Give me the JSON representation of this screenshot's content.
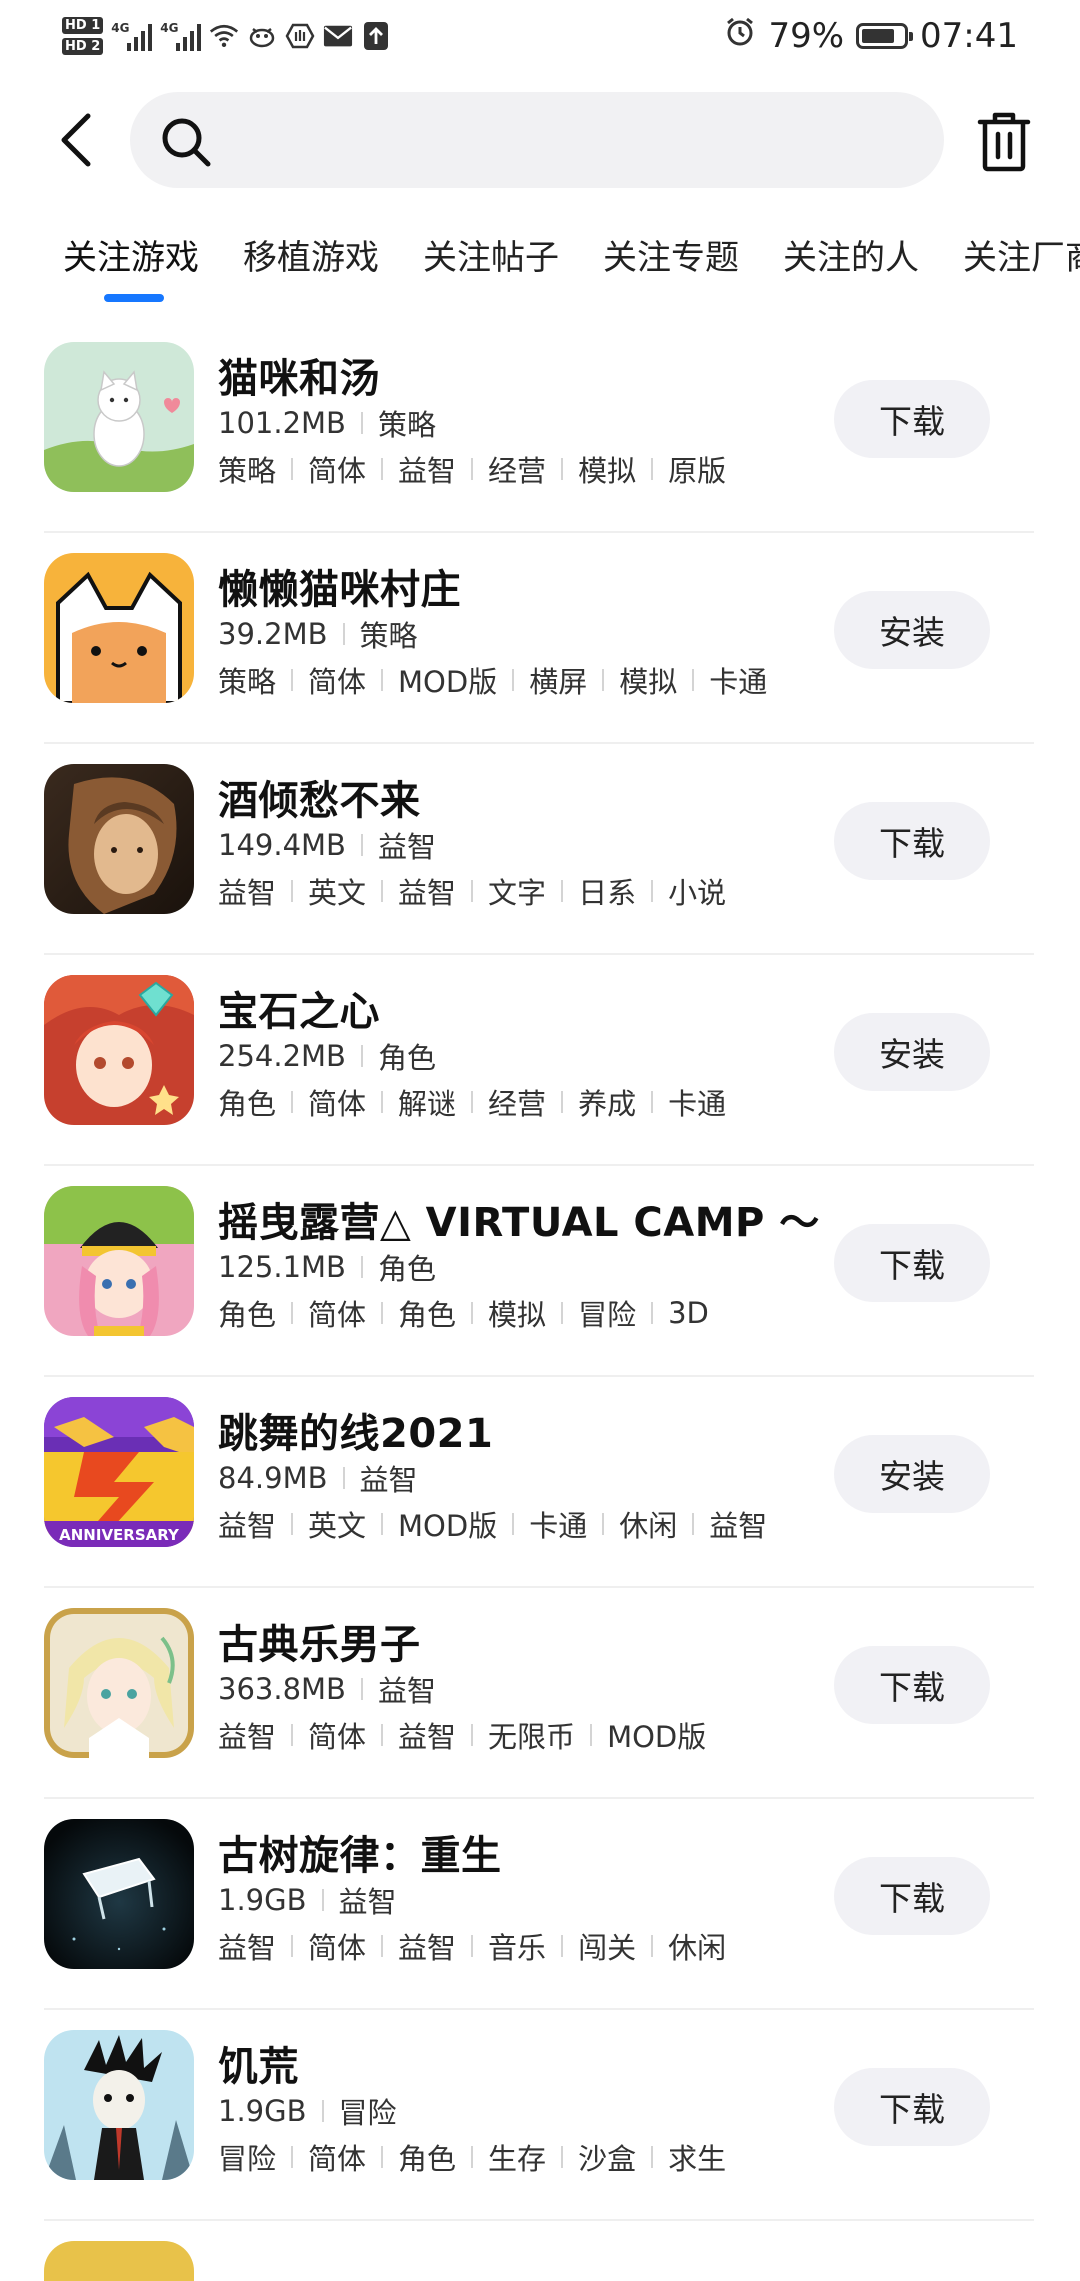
{
  "status_bar": {
    "hd1": "HD 1",
    "hd2": "HD 2",
    "sig1_label": "4G",
    "sig2_label": "4G",
    "battery_pct": "79%",
    "battery_level": 0.79,
    "time": "07:41",
    "icons": [
      "wifi-icon",
      "bird-icon",
      "hand-icon",
      "mail-icon",
      "upload-icon",
      "alarm-icon",
      "battery-icon"
    ]
  },
  "search": {
    "placeholder": ""
  },
  "tabs": [
    {
      "label": "关注游戏",
      "active": true
    },
    {
      "label": "移植游戏",
      "active": false
    },
    {
      "label": "关注帖子",
      "active": false
    },
    {
      "label": "关注专题",
      "active": false
    },
    {
      "label": "关注的人",
      "active": false
    },
    {
      "label": "关注厂商",
      "active": false
    }
  ],
  "accent_color": "#1677ff",
  "games": [
    {
      "title": "猫咪和汤",
      "size": "101.2MB",
      "category": "策略",
      "tags": [
        "策略",
        "简体",
        "益智",
        "经营",
        "模拟",
        "原版"
      ],
      "action": "下载"
    },
    {
      "title": "懒懒猫咪村庄",
      "size": "39.2MB",
      "category": "策略",
      "tags": [
        "策略",
        "简体",
        "MOD版",
        "横屏",
        "模拟",
        "卡通"
      ],
      "action": "安装"
    },
    {
      "title": "酒倾愁不来",
      "size": "149.4MB",
      "category": "益智",
      "tags": [
        "益智",
        "英文",
        "益智",
        "文字",
        "日系",
        "小说"
      ],
      "action": "下载"
    },
    {
      "title": "宝石之心",
      "size": "254.2MB",
      "category": "角色",
      "tags": [
        "角色",
        "简体",
        "解谜",
        "经营",
        "养成",
        "卡通"
      ],
      "action": "安装"
    },
    {
      "title": "摇曳露营△ VIRTUAL CAMP ～",
      "size": "125.1MB",
      "category": "角色",
      "tags": [
        "角色",
        "简体",
        "角色",
        "模拟",
        "冒险",
        "3D"
      ],
      "action": "下载"
    },
    {
      "title": "跳舞的线2021",
      "size": "84.9MB",
      "category": "益智",
      "tags": [
        "益智",
        "英文",
        "MOD版",
        "卡通",
        "休闲",
        "益智"
      ],
      "action": "安装"
    },
    {
      "title": "古典乐男子",
      "size": "363.8MB",
      "category": "益智",
      "tags": [
        "益智",
        "简体",
        "益智",
        "无限币",
        "MOD版"
      ],
      "action": "下载"
    },
    {
      "title": "古树旋律：重生",
      "size": "1.9GB",
      "category": "益智",
      "tags": [
        "益智",
        "简体",
        "益智",
        "音乐",
        "闯关",
        "休闲"
      ],
      "action": "下载"
    },
    {
      "title": "饥荒",
      "size": "1.9GB",
      "category": "冒险",
      "tags": [
        "冒险",
        "简体",
        "角色",
        "生存",
        "沙盒",
        "求生"
      ],
      "action": "下载"
    }
  ],
  "thumb_labels": {
    "anniversary": "ANNIVERSARY"
  }
}
